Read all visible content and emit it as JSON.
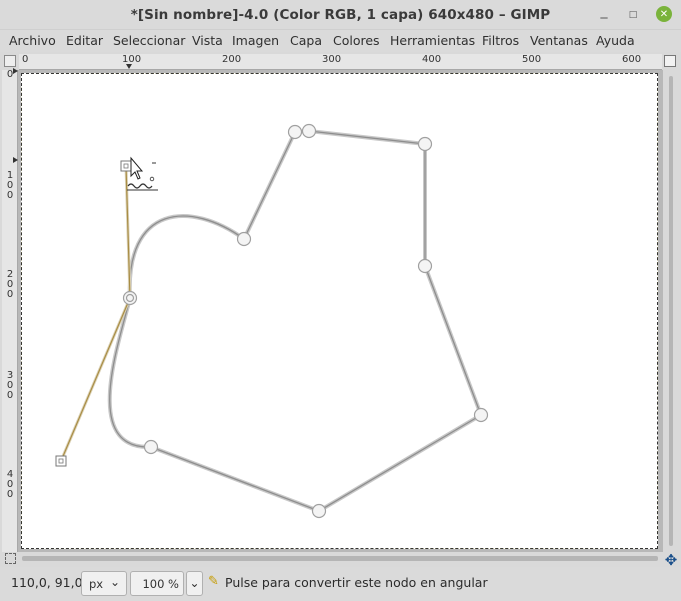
{
  "window": {
    "title": "*[Sin nombre]-4.0 (Color RGB, 1 capa) 640x480 – GIMP",
    "controls": {
      "minimize": "_",
      "maximize": "□",
      "close": "✕"
    }
  },
  "menu": {
    "items": [
      "Archivo",
      "Editar",
      "Seleccionar",
      "Vista",
      "Imagen",
      "Capa",
      "Colores",
      "Herramientas",
      "Filtros",
      "Ventanas",
      "Ayuda"
    ]
  },
  "rulers": {
    "horizontal": [
      "0",
      "100",
      "200",
      "300",
      "400",
      "500",
      "600"
    ],
    "vertical": [
      "0",
      "100",
      "200",
      "300",
      "400"
    ]
  },
  "statusbar": {
    "coords": "110,0, 91,0",
    "unit": "px",
    "zoom": "100 %",
    "hint": "Pulse para convertir este nodo en angular"
  },
  "colors": {
    "path_stroke": "#9a9a9a",
    "handle_line": "#b59a5a",
    "selection_border": "#d4c400",
    "close_button": "#7ab33b"
  },
  "icons": {
    "close": "close-icon",
    "navigate": "navigate-icon",
    "hint": "paths-tool-hint-icon",
    "quick_mask": "quick-mask-icon"
  }
}
